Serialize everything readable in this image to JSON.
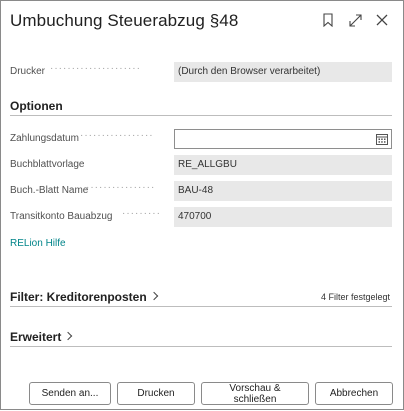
{
  "dialog": {
    "title": "Umbuchung Steuerabzug §48",
    "icons": [
      "bookmark-icon",
      "expand-icon",
      "close-icon"
    ]
  },
  "printer": {
    "label": "Drucker",
    "value": "(Durch den Browser verarbeitet)"
  },
  "options": {
    "title": "Optionen",
    "fields": [
      {
        "label": "Zahlungsdatum",
        "value": ""
      },
      {
        "label": "Buchblattvorlage",
        "value": "RE_ALLGBU"
      },
      {
        "label": "Buch.-Blatt Name",
        "value": "BAU-48"
      },
      {
        "label": "Transitkonto Bauabzug",
        "value": "470700"
      }
    ],
    "help_link": "RELion Hilfe"
  },
  "filter": {
    "title": "Filter: Kreditorenposten",
    "status": "4 Filter festgelegt"
  },
  "advanced": {
    "title": "Erweitert"
  },
  "buttons": {
    "send": "Senden an...",
    "print": "Drucken",
    "preview": "Vorschau & schließen",
    "cancel": "Abbrechen"
  }
}
